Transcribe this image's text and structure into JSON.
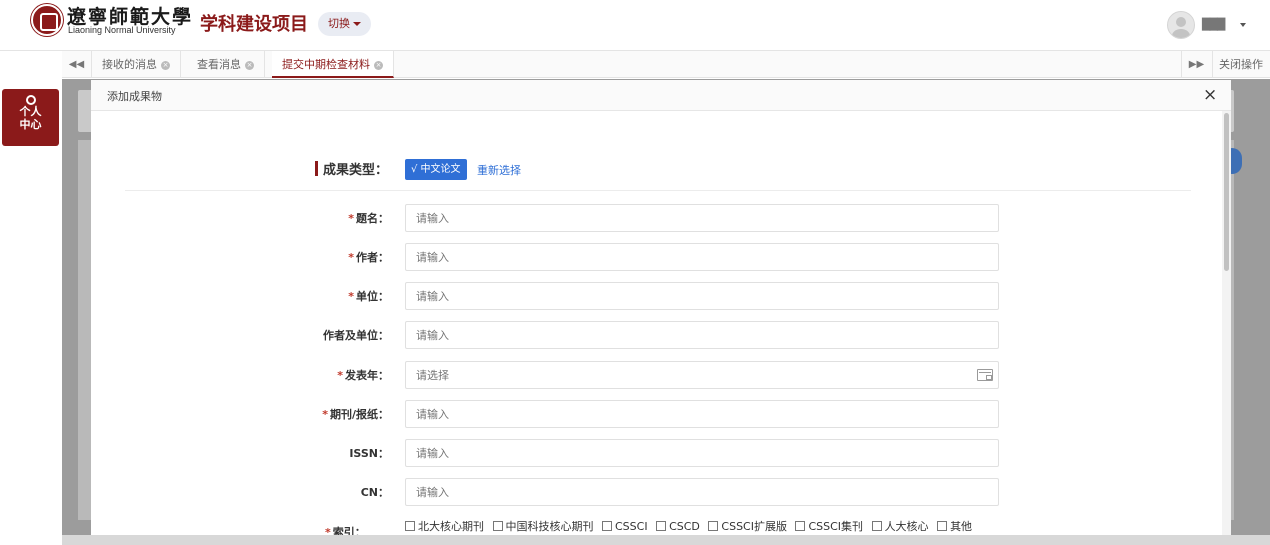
{
  "header": {
    "university_cn": "遼寧師範大學",
    "university_en": "Liaoning Normal University",
    "app_title": "学科建设项目",
    "switch_label": "切换",
    "username": "███"
  },
  "tabs": {
    "prev_glyph": "◀◀",
    "next_glyph": "▶▶",
    "items": [
      {
        "label": "接收的消息"
      },
      {
        "label": "查看消息"
      },
      {
        "label": "提交中期检查材料"
      }
    ],
    "close_ops": "关闭操作"
  },
  "sidebar": {
    "personal_line1": "个人",
    "personal_line2": "中心"
  },
  "modal": {
    "title": "添加成果物",
    "close_glyph": "×",
    "type_label": "成果类型：",
    "type_value": "√ 中文论文",
    "reselect": "重新选择",
    "fields": [
      {
        "label": "题名：",
        "required": "*",
        "placeholder": "请输入"
      },
      {
        "label": "作者：",
        "required": "*",
        "placeholder": "请输入"
      },
      {
        "label": "单位：",
        "required": "*",
        "placeholder": "请输入"
      },
      {
        "label": "作者及单位：",
        "required": "",
        "placeholder": "请输入"
      },
      {
        "label": "发表年：",
        "required": "*",
        "placeholder": "请选择"
      },
      {
        "label": "期刊/报纸：",
        "required": "*",
        "placeholder": "请输入"
      },
      {
        "label": "ISSN：",
        "required": "",
        "placeholder": "请输入"
      },
      {
        "label": "CN：",
        "required": "",
        "placeholder": "请输入"
      }
    ],
    "index_label": "索引：",
    "index_required": "*",
    "index_options": [
      "北大核心期刊",
      "中国科技核心期刊",
      "CSSCI",
      "CSCD",
      "CSSCI扩展版",
      "CSSCI集刊",
      "人大核心",
      "其他"
    ]
  }
}
